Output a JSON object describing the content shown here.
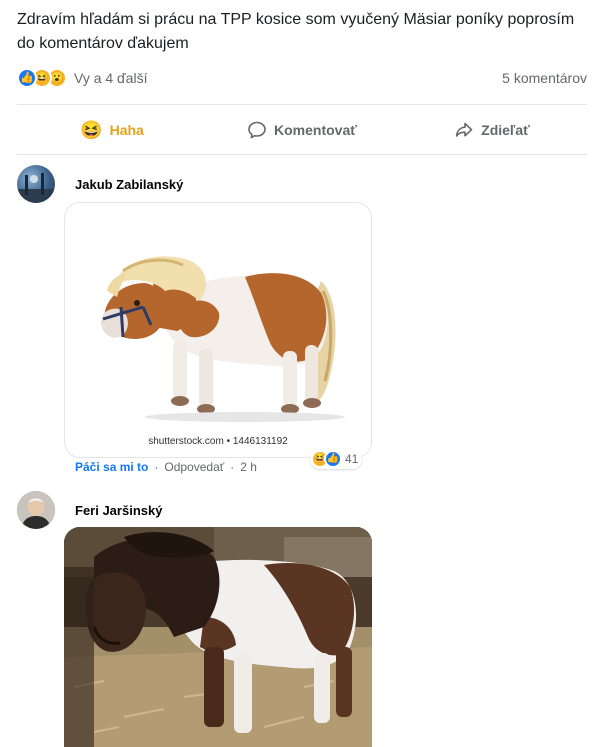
{
  "post": {
    "text": "Zdravím hľadám si prácu na TPP kosice som vyučený Mäsiar poníky poprosím do komentárov ďakujem",
    "reaction_names": "Vy a 4 ďalší",
    "comments_count": "5 komentárov"
  },
  "actions": {
    "haha_label": "Haha",
    "comment_label": "Komentovať",
    "share_label": "Zdieľať"
  },
  "comments": [
    {
      "author": "Jakub Zabilanský",
      "image_watermark": "shutterstock.com • 1446131192",
      "like_label": "Páči sa mi to",
      "reply_label": "Odpovedať",
      "time": "2 h",
      "reactions_count": "41"
    },
    {
      "author": "Feri Jaršinský"
    }
  ],
  "colors": {
    "accent": "#1877f2",
    "haha": "#e8a11b",
    "muted_text": "#65676b"
  }
}
